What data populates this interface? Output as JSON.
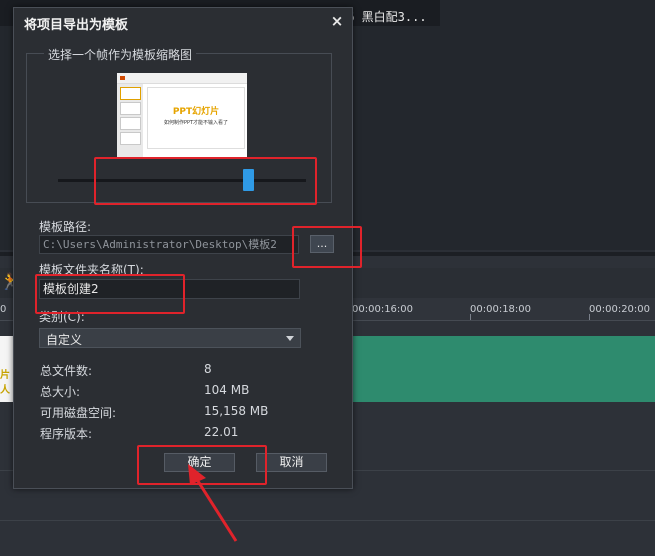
{
  "background": {
    "clip_caption": "36 黑白配3...",
    "ruler_ticks": [
      "0",
      "00:00:16:00",
      "00:00:18:00",
      "00:00:20:00"
    ],
    "thumb_text": "片\n人"
  },
  "dialog": {
    "title": "将项目导出为模板",
    "close_glyph": "×",
    "thumbnail_group_label": "选择一个帧作为模板缩略图",
    "preview": {
      "slide_title": "PPT幻灯片",
      "slide_subtitle": "如何制作PPT才能不输入看了"
    },
    "slider_value": 0.75,
    "path_label": "模板路径:",
    "path_value": "C:\\Users\\Administrator\\Desktop\\模板2",
    "browse_label": "...",
    "folder_label": "模板文件夹名称(T):",
    "folder_value": "模板创建2",
    "category_label": "类别(C):",
    "category_value": "自定义",
    "stats": [
      {
        "key": "总文件数:",
        "value": "8"
      },
      {
        "key": "总大小:",
        "value": "104 MB"
      },
      {
        "key": "可用磁盘空间:",
        "value": "15,158 MB"
      },
      {
        "key": "程序版本:",
        "value": "22.01"
      }
    ],
    "ok_label": "确定",
    "cancel_label": "取消"
  },
  "colors": {
    "annotation": "#e0232b",
    "accent": "#2f9ae6",
    "track": "#2e8b6e"
  }
}
